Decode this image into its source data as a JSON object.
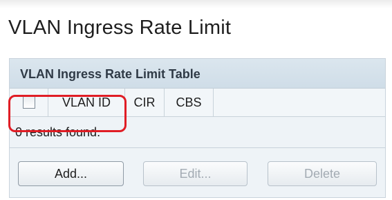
{
  "page": {
    "title": "VLAN Ingress Rate Limit"
  },
  "table": {
    "title": "VLAN Ingress Rate Limit Table",
    "columns": [
      "VLAN ID",
      "CIR",
      "CBS"
    ],
    "select_all_checked": false,
    "results_text": "0 results found."
  },
  "buttons": {
    "add": "Add...",
    "edit": "Edit...",
    "delete": "Delete"
  },
  "colors": {
    "highlight": "#e01d25",
    "header_bg": "#d3e0ea"
  }
}
